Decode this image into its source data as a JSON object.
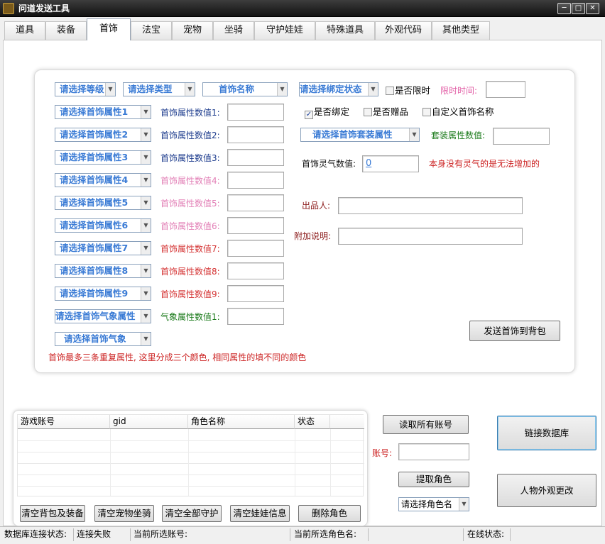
{
  "window": {
    "title": "问道发送工具",
    "minimize": "─",
    "maximize": "□",
    "close": "✕"
  },
  "tabs": [
    "道具",
    "装备",
    "首饰",
    "法宝",
    "宠物",
    "坐骑",
    "守护娃娃",
    "特殊道具",
    "外观代码",
    "其他类型"
  ],
  "form": {
    "level_select": "请选择等级",
    "type_select": "请选择类型",
    "name_select": "首饰名称",
    "bind_state_select": "请选择绑定状态",
    "limited_checkbox": "是否限时",
    "limit_time_label": "限时时间:",
    "is_bound_checkbox": "是否绑定",
    "is_gift_checkbox": "是否赠品",
    "custom_name_checkbox": "自定义首饰名称",
    "attr_selects": [
      "请选择首饰属性1",
      "请选择首饰属性2",
      "请选择首饰属性3",
      "请选择首饰属性4",
      "请选择首饰属性5",
      "请选择首饰属性6",
      "请选择首饰属性7",
      "请选择首饰属性8",
      "请选择首饰属性9"
    ],
    "attr_value_labels": [
      "首饰属性数值1:",
      "首饰属性数值2:",
      "首饰属性数值3:",
      "首饰属性数值4:",
      "首饰属性数值5:",
      "首饰属性数值6:",
      "首饰属性数值7:",
      "首饰属性数值8:",
      "首饰属性数值9:"
    ],
    "aura_attr_select": "请选择首饰气象属性",
    "aura_value_label": "气象属性数值1:",
    "aura_select": "请选择首饰气象",
    "set_attr_select": "请选择首饰套装属性",
    "set_value_label": "套装属性数值:",
    "spirit_label": "首饰灵气数值:",
    "spirit_value": "0",
    "spirit_note": "本身没有灵气的是无法增加的",
    "producer_label": "出品人:",
    "remark_label": "附加说明:",
    "send_button": "发送首饰到背包",
    "note": "首饰最多三条重复属性, 这里分成三个颜色, 相同属性的填不同的颜色"
  },
  "account_grid": {
    "columns": [
      "游戏账号",
      "gid",
      "角色名称",
      "状态"
    ]
  },
  "actions": {
    "clear_bag": "清空背包及装备",
    "clear_pet": "清空宠物坐骑",
    "clear_guard": "清空全部守护",
    "clear_doll": "清空娃娃信息",
    "delete_role": "删除角色",
    "read_accounts": "读取所有账号",
    "account_label": "账号:",
    "fetch_role": "提取角色",
    "role_select": "请选择角色名",
    "link_db": "链接数据库",
    "change_look": "人物外观更改"
  },
  "status": {
    "db_label": "数据库连接状态:",
    "db_value": "连接失败",
    "account_label": "当前所选账号:",
    "role_label": "当前所选角色名:",
    "online_label": "在线状态:"
  },
  "colors": {
    "combo_text": "#3a7bd5",
    "attr_group1": "#1b3a8c",
    "attr_group2": "#e25fa6",
    "attr_group3": "#d43232",
    "aura": "#1a7a1a",
    "set": "#1a7a1a",
    "warning": "#cc2222"
  }
}
